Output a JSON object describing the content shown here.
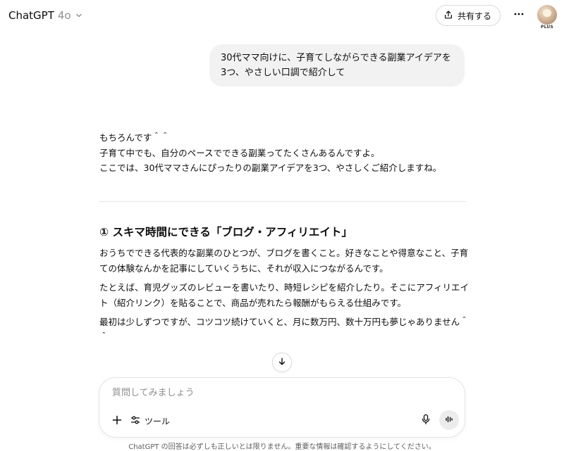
{
  "header": {
    "title": "ChatGPT",
    "model": "4o",
    "share_label": "共有する",
    "avatar_badge": "PLUS",
    "icons": {
      "chevron": "chevron-down-icon",
      "share": "share-icon",
      "more": "more-icon"
    }
  },
  "user_message": "30代ママ向けに、子育てしながらできる副業アイデアを3つ、やさしい口調で紹介して",
  "assistant": {
    "intro": [
      "もちろんです＾＾",
      "子育て中でも、自分のペースでできる副業ってたくさんあるんですよ。",
      "ここでは、30代ママさんにぴったりの副業アイデアを3つ、やさしくご紹介しますね。"
    ],
    "section1": {
      "heading": "① スキマ時間にできる「ブログ・アフィリエイト」",
      "paragraphs": [
        "おうちでできる代表的な副業のひとつが、ブログを書くこと。好きなことや得意なこと、子育ての体験なんかを記事にしていくうちに、それが収入につながるんです。",
        "たとえば、育児グッズのレビューを書いたり、時短レシピを紹介したり。そこにアフィリエイト（紹介リンク）を貼ることで、商品が売れたら報酬がもらえる仕組みです。",
        "最初は少しずつですが、コツコツ続けていくと、月に数万円、数十万円も夢じゃありません＾＾"
      ]
    }
  },
  "composer": {
    "placeholder": "質問してみましょう",
    "tools_label": "ツール",
    "icons": {
      "plus": "plus-icon",
      "tools": "sliders-icon",
      "mic": "mic-icon",
      "voice": "voice-mode-icon"
    }
  },
  "footer_note": "ChatGPT の回答は必ずしも正しいとは限りません。重要な情報は確認するようにしてください。"
}
